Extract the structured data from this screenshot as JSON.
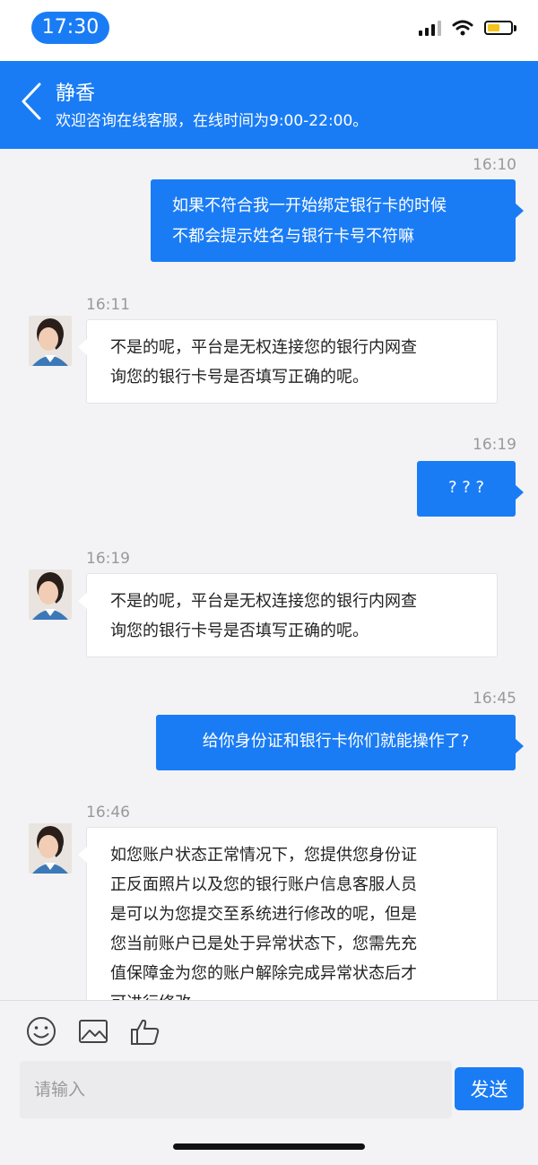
{
  "status_bar": {
    "time": "17:30",
    "battery_level": 0.55,
    "accent": "#1a7cf5"
  },
  "header": {
    "title": "静香",
    "subtitle": "欢迎咨询在线客服，在线时间为9:00-22:00。"
  },
  "messages": [
    {
      "time": "16:10",
      "from": "user",
      "lines": [
        "如果不符合我一开始绑定银行卡的时候",
        "不都会提示姓名与银行卡号不符嘛"
      ]
    },
    {
      "time": "16:11",
      "from": "agent",
      "lines": [
        "不是的呢，平台是无权连接您的银行内网查",
        "询您的银行卡号是否填写正确的呢。"
      ]
    },
    {
      "time": "16:19",
      "from": "user",
      "lines": [
        "? ? ?"
      ]
    },
    {
      "time": "16:19",
      "from": "agent",
      "lines": [
        "不是的呢，平台是无权连接您的银行内网查",
        "询您的银行卡号是否填写正确的呢。"
      ]
    },
    {
      "time": "16:45",
      "from": "user",
      "lines": [
        "给你身份证和银行卡你们就能操作了?"
      ]
    },
    {
      "time": "16:46",
      "from": "agent",
      "lines": [
        "如您账户状态正常情况下，您提供您身份证",
        "正反面照片以及您的银行账户信息客服人员",
        "是可以为您提交至系统进行修改的呢，但是",
        "您当前账户已是处于异常状态下，您需先充",
        "值保障金为您的账户解除完成异常状态后才",
        "可进行修改。"
      ]
    }
  ],
  "composer": {
    "tools": [
      "emoji-icon",
      "image-icon",
      "thumbs-up-icon"
    ],
    "placeholder": "请输入",
    "send_label": "发送"
  }
}
